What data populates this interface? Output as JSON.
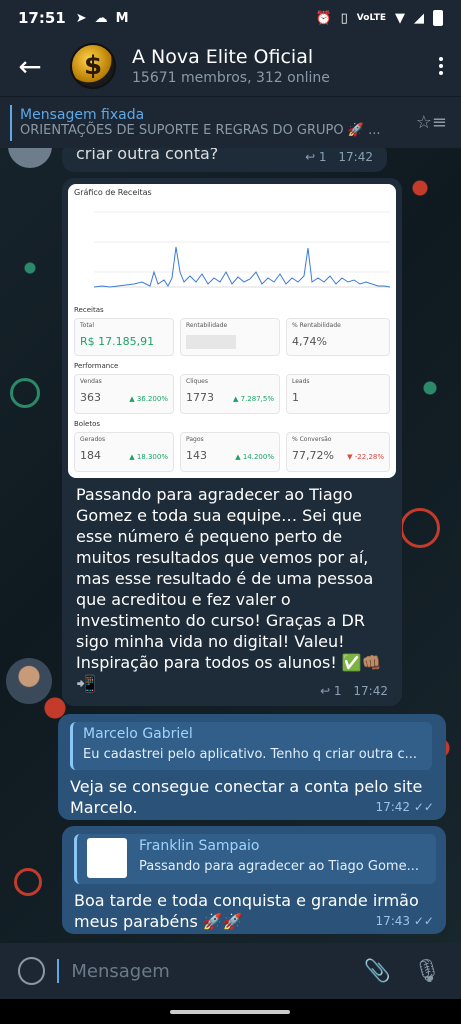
{
  "status": {
    "time": "17:51",
    "network": "VoLTE"
  },
  "header": {
    "title": "A Nova Elite Oficial",
    "subtitle": "15671 membros, 312 online"
  },
  "pinned": {
    "label": "Mensagem fixada",
    "text": "ORIENTAÇÕES DE SUPORTE E REGRAS DO GRUPO 🚀 ..."
  },
  "messages": {
    "m1": {
      "text": "criar outra conta?",
      "forwards": "↩ 1",
      "time": "17:42"
    },
    "m2": {
      "text": "Passando para agradecer ao Tiago Gomez e toda sua equipe… Sei que esse número é pequeno perto de muitos resultados que vemos por aí, mas esse resultado é de uma pessoa que acreditou e fez valer o investimento do curso! Graças a DR sigo minha vida no digital! Valeu! Inspiração para todos os alunos! ✅👊🏽📲",
      "forwards": "↩ 1",
      "time": "17:42",
      "screenshot": {
        "chart_title": "Gráfico de Receitas",
        "sections": {
          "receitas": "Receitas",
          "performance": "Performance",
          "boletos": "Boletos"
        },
        "cards": {
          "total_label": "Total",
          "total_value": "R$ 17.185,91",
          "rent_label": "Rentabilidade",
          "rent_value": "",
          "pct_rent_label": "% Rentabilidade",
          "pct_rent_value": "4,74%",
          "vendas_label": "Vendas",
          "vendas_value": "363",
          "vendas_change": "▲ 36.200%",
          "cliques_label": "Cliques",
          "cliques_value": "1773",
          "cliques_change": "▲ 7.287,5%",
          "leads_label": "Leads",
          "leads_value": "1",
          "gerados_label": "Gerados",
          "gerados_value": "184",
          "gerados_change": "▲ 18.300%",
          "pagos_label": "Pagos",
          "pagos_value": "143",
          "pagos_change": "▲ 14.200%",
          "conv_label": "% Conversão",
          "conv_value": "77,72%",
          "conv_change": "▼ -22,28%"
        }
      }
    },
    "m3": {
      "quote_name": "Marcelo Gabriel",
      "quote_text": "Eu cadastrei pelo aplicativo. Tenho q criar outra c...",
      "text_line1": "Veja se consegue conectar a conta pelo site",
      "text_line2": "Marcelo.",
      "time": "17:42 ✓✓"
    },
    "m4": {
      "quote_name": "Franklin Sampaio",
      "quote_text": "Passando para agradecer ao Tiago Gome...",
      "text_line1": "Boa tarde e toda conquista e grande irmão",
      "text_line2": "meus parabéns 🚀🚀",
      "time": "17:43 ✓✓"
    }
  },
  "input": {
    "placeholder": "Mensagem"
  }
}
